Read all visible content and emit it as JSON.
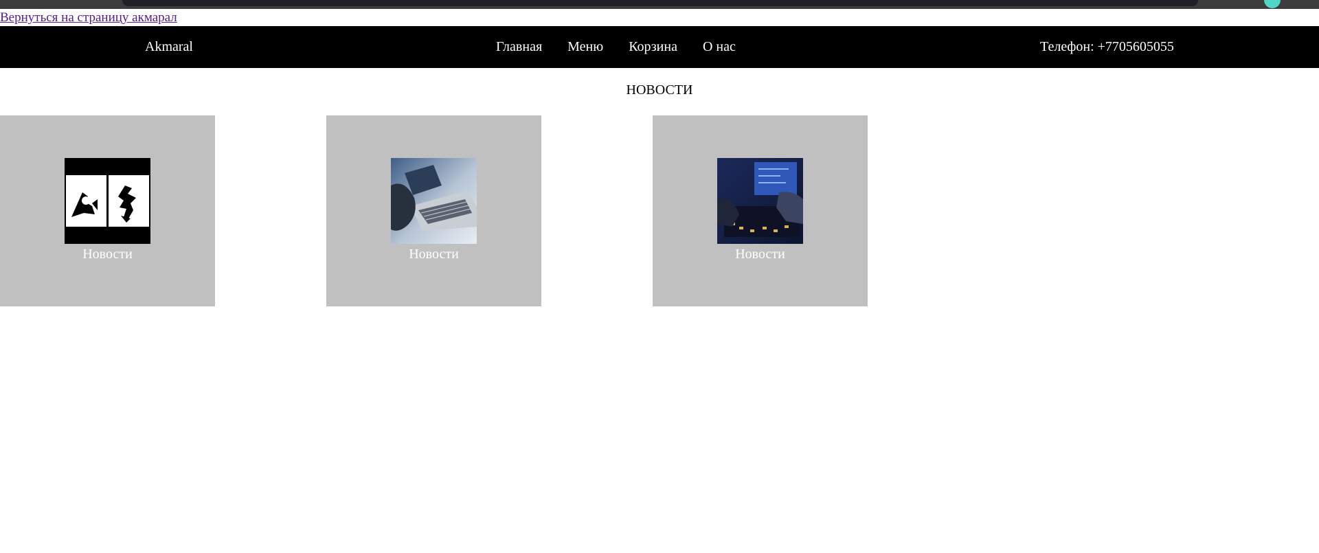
{
  "back_link": {
    "label": "Вернуться на страницу акмарал"
  },
  "header": {
    "brand": "Akmaral",
    "nav": [
      {
        "label": "Главная"
      },
      {
        "label": "Меню"
      },
      {
        "label": "Корзина"
      },
      {
        "label": "О нас"
      }
    ],
    "phone": "Телефон: +7705605055"
  },
  "main": {
    "title": "НОВОСТИ",
    "cards": [
      {
        "caption": "Новости",
        "image": "abstract-glyphs-image"
      },
      {
        "caption": "Новости",
        "image": "laptop-card-image"
      },
      {
        "caption": "Новости",
        "image": "hacker-keyboard-image"
      }
    ]
  },
  "colors": {
    "navbar": "#000000",
    "card": "#c0c0c0",
    "link": "#551a8b"
  }
}
